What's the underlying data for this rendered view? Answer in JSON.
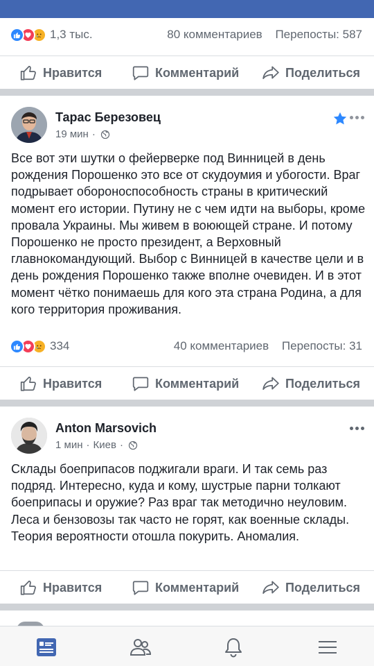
{
  "post_prev": {
    "reactions_count": "1,3 тыс.",
    "comments": "80 комментариев",
    "shares": "Перепосты: 587"
  },
  "actions": {
    "like": "Нравится",
    "comment": "Комментарий",
    "share": "Поделиться"
  },
  "post1": {
    "author": "Тарас Березовец",
    "time": "19 мин",
    "text": "Все вот эти шутки о фейерверке под Винницей в день рождения Порошенко это все от скудоумия и убогости. Враг подрывает обороноспособность страны в критический момент его истории. Путину не с чем идти на выборы, кроме провала Украины. Мы живем в воюющей стране. И потому Порошенко не просто президент, а Верховный главнокомандующий. Выбор с Винницей в качестве цели и в день рождения Порошенко также вполне очевиден. И в этот момент чётко понимаешь для кого эта страна Родина, а для кого территория проживания.",
    "reactions_count": "334",
    "comments": "40 комментариев",
    "shares": "Перепосты: 31"
  },
  "post2": {
    "author": "Anton Marsovich",
    "time": "1 мин",
    "location": "Киев",
    "text": "Склады боеприпасов поджигали враги. И так семь раз подряд. Интересно, куда и кому, шустрые парни толкают боеприпасы и оружие? Раз враг так методично неуловим. Леса и бензовозы так часто не горят, как военные склады. Теория вероятности отошла покурить. Аномалия."
  },
  "colors": {
    "brand": "#4267b2",
    "like": "#2d88ff",
    "love": "#f33e58",
    "sad": "#f7b125",
    "star": "#2d88ff"
  },
  "icons": {
    "like": "thumbs-up-icon",
    "comment": "comment-bubble-icon",
    "share": "share-arrow-icon",
    "globe": "globe-icon",
    "feed": "news-feed-icon",
    "friends": "friends-icon",
    "notifications": "bell-icon",
    "menu": "hamburger-menu-icon"
  }
}
